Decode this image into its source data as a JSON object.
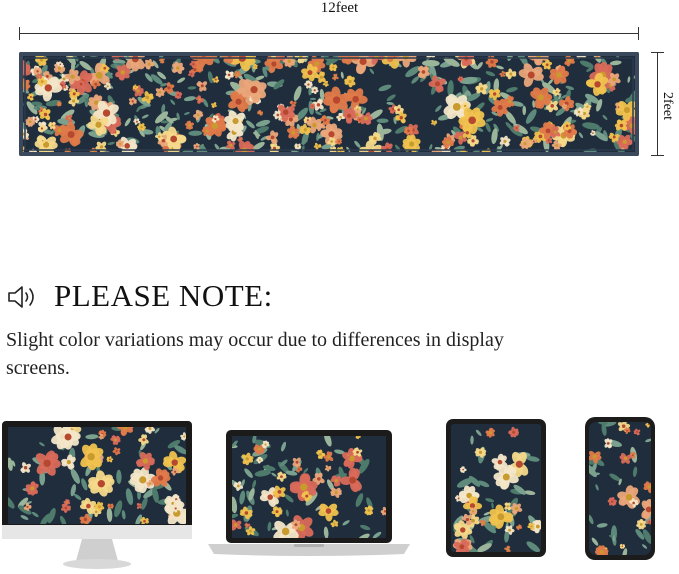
{
  "dimensions": {
    "width_label": "12feet",
    "height_label": "2feet"
  },
  "note": {
    "title": "PLEASE NOTE:",
    "body": "Slight color variations may occur due to differences in display screens.",
    "icon": "speaker-icon"
  },
  "devices": [
    {
      "type": "monitor"
    },
    {
      "type": "laptop"
    },
    {
      "type": "tablet"
    },
    {
      "type": "phone"
    }
  ],
  "colors": {
    "background": "#1f2d3d",
    "border": "#3a4a5c",
    "flower_orange": "#e07a4a",
    "flower_yellow": "#f0c24e",
    "flower_cream": "#f3e6c8",
    "flower_peach": "#eaa67a",
    "leaf": "#5d8a7a"
  }
}
